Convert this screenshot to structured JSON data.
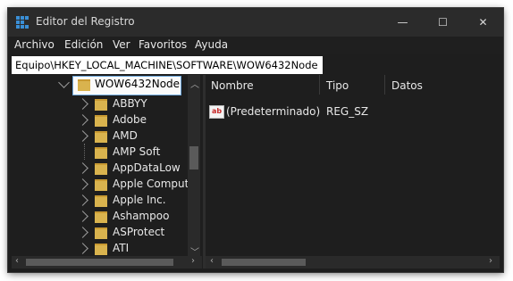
{
  "window": {
    "title": "Editor del Registro",
    "app_icon": "regedit-icon"
  },
  "window_controls": {
    "minimize": "—",
    "maximize": "☐",
    "close": "✕"
  },
  "menu": [
    "Archivo",
    "Edición",
    "Ver",
    "Favoritos",
    "Ayuda"
  ],
  "address": "Equipo\\HKEY_LOCAL_MACHINE\\SOFTWARE\\WOW6432Node",
  "tree": {
    "selected": "WOW6432Node",
    "children": [
      "ABBYY",
      "Adobe",
      "AMD",
      "AMP Soft",
      "AppDataLow",
      "Apple Computer",
      "Apple Inc.",
      "Ashampoo",
      "ASProtect",
      "ATI"
    ]
  },
  "values_table": {
    "columns": [
      "Nombre",
      "Tipo",
      "Datos"
    ],
    "rows": [
      {
        "name": "(Predeterminado)",
        "type": "REG_SZ",
        "data": ""
      }
    ]
  },
  "colors": {
    "accent": "#3a8fd6",
    "folder": "#d9b34e",
    "background": "#1e1e1e"
  }
}
